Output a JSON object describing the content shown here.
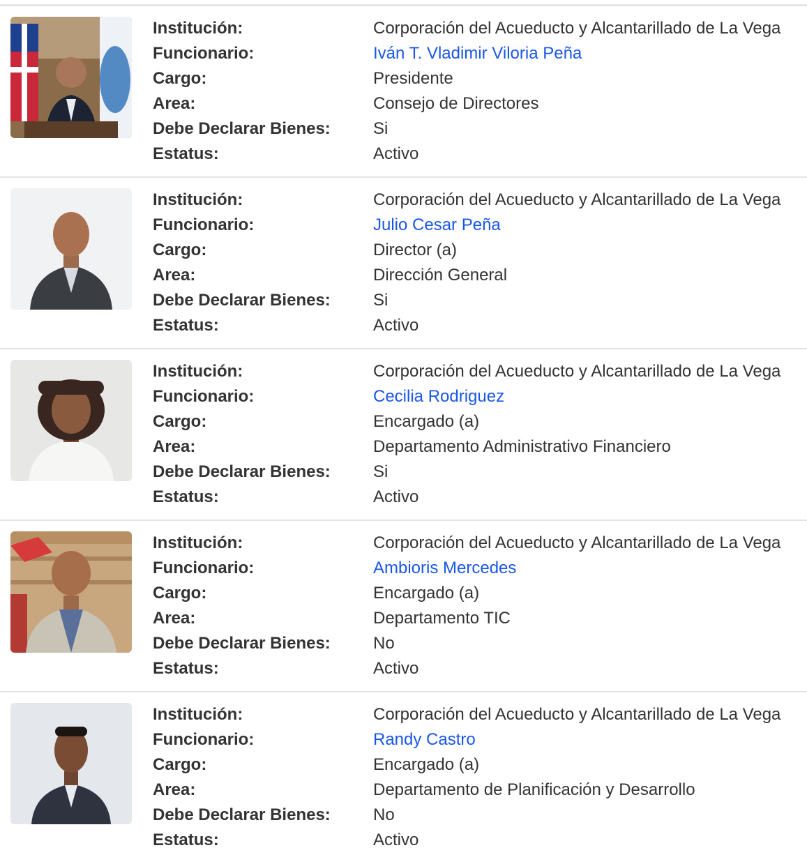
{
  "labels": {
    "institucion": "Institución:",
    "funcionario": "Funcionario:",
    "cargo": "Cargo:",
    "area": "Area:",
    "debe_declarar": "Debe Declarar Bienes:",
    "estatus": "Estatus:"
  },
  "colors": {
    "link": "#1a56e8",
    "text": "#333333",
    "divider": "#e3e3e3"
  },
  "records": [
    {
      "institucion": "Corporación del Acueducto y Alcantarillado de La Vega",
      "funcionario": "Iván T. Vladimir Viloria Peña",
      "cargo": "Presidente",
      "area": "Consejo de Directores",
      "debe_declarar": "Si",
      "estatus": "Activo"
    },
    {
      "institucion": "Corporación del Acueducto y Alcantarillado de La Vega",
      "funcionario": "Julio Cesar Peña",
      "cargo": "Director (a)",
      "area": "Dirección General",
      "debe_declarar": "Si",
      "estatus": "Activo"
    },
    {
      "institucion": "Corporación del Acueducto y Alcantarillado de La Vega",
      "funcionario": "Cecilia Rodriguez",
      "cargo": "Encargado (a)",
      "area": "Departamento Administrativo Financiero",
      "debe_declarar": "Si",
      "estatus": "Activo"
    },
    {
      "institucion": "Corporación del Acueducto y Alcantarillado de La Vega",
      "funcionario": "Ambioris Mercedes",
      "cargo": "Encargado (a)",
      "area": "Departamento TIC",
      "debe_declarar": "No",
      "estatus": "Activo"
    },
    {
      "institucion": "Corporación del Acueducto y Alcantarillado de La Vega",
      "funcionario": "Randy Castro",
      "cargo": "Encargado (a)",
      "area": "Departamento de Planificación y Desarrollo",
      "debe_declarar": "No",
      "estatus": "Activo"
    }
  ]
}
